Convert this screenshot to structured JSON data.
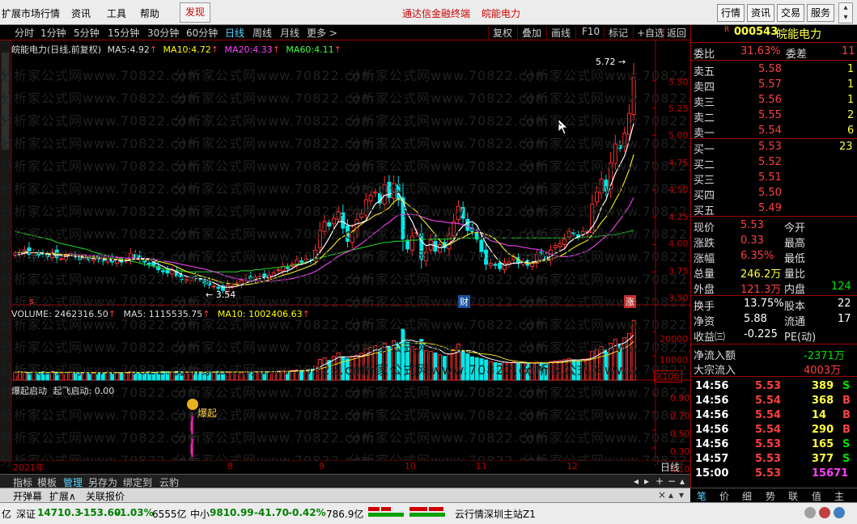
{
  "menubar": {
    "items": [
      "扩展市场行情",
      "资讯",
      "工具",
      "帮助"
    ],
    "discover": "发现",
    "title_app": "通达信金融终端",
    "title_stock": "皖能电力",
    "right_buttons": [
      "行情",
      "资讯",
      "交易",
      "服务"
    ]
  },
  "period_toolbar": {
    "periods": [
      "分时",
      "1分钟",
      "5分钟",
      "15分钟",
      "30分钟",
      "60分钟",
      "日线",
      "周线",
      "月线",
      "更多 >"
    ],
    "active": "日线",
    "tools": [
      "复权",
      "叠加",
      "画线",
      "F10",
      "标记",
      "+自选",
      "返回"
    ]
  },
  "price_header": {
    "name": "皖能电力(日线,前复权)",
    "ma5_label": "MA5:",
    "ma5": "4.92",
    "ma10_label": "MA10:",
    "ma10": "4.72",
    "ma20_label": "MA20:",
    "ma20": "4.33",
    "ma60_label": "MA60:",
    "ma60": "4.11"
  },
  "volume_header": {
    "label": "VOLUME:",
    "value": "2462316.50",
    "ma5_label": "MA5:",
    "ma5": "1115535.75",
    "ma10_label": "MA10:",
    "ma10": "1002406.63"
  },
  "indicator_header": {
    "text1": "爆起启动",
    "text2": "起飞启动: 0.00"
  },
  "indicator_marker": "爆起",
  "price_axis": [
    "5.50",
    "5.25",
    "5.00",
    "4.75",
    "4.50",
    "4.25",
    "4.00",
    "3.75",
    "3.50"
  ],
  "volume_axis": [
    "20000",
    "10000"
  ],
  "volume_unit": "X100",
  "indicator_axis": [
    "0.90",
    "0.70",
    "0.50",
    "0.30",
    "0.10"
  ],
  "annotations": {
    "high": "5.72",
    "low": "3.54"
  },
  "event_markers": {
    "s": "s",
    "cai": "财",
    "zhang": "涨"
  },
  "date_axis": {
    "year": "2021年",
    "months": [
      "8",
      "9",
      "10",
      "11",
      "12"
    ]
  },
  "period_label": "日线",
  "watermark": "分析家公式网www.70822.com",
  "chart_data": {
    "type": "candlestick",
    "title": "皖能电力(日线,前复权)",
    "ylim": [
      3.5,
      5.72
    ],
    "close": [
      3.92,
      3.93,
      3.95,
      3.91,
      3.93,
      3.9,
      3.91,
      3.89,
      3.93,
      3.88,
      3.87,
      3.9,
      3.92,
      3.89,
      3.86,
      3.88,
      3.86,
      3.87,
      3.87,
      3.85,
      3.86,
      3.84,
      3.86,
      3.84,
      3.86,
      3.92,
      3.88,
      3.87,
      3.84,
      3.82,
      3.81,
      3.77,
      3.75,
      3.74,
      3.76,
      3.71,
      3.68,
      3.68,
      3.69,
      3.7,
      3.68,
      3.64,
      3.63,
      3.62,
      3.6,
      3.58,
      3.63,
      3.62,
      3.65,
      3.67,
      3.69,
      3.69,
      3.7,
      3.71,
      3.7,
      3.72,
      3.74,
      3.77,
      3.8,
      3.78,
      3.82,
      3.86,
      3.84,
      3.87,
      3.86,
      3.95,
      4.13,
      4.21,
      4.17,
      4.24,
      4.3,
      4.15,
      4.03,
      4.13,
      4.23,
      4.28,
      4.41,
      4.45,
      4.48,
      4.38,
      4.55,
      4.43,
      4.56,
      4.41,
      4.05,
      3.96,
      4.08,
      4.11,
      3.86,
      3.93,
      4.04,
      3.94,
      4,
      3.97,
      4.09,
      4.21,
      4.35,
      4.24,
      4.13,
      4.12,
      4.05,
      3.93,
      3.82,
      3.83,
      3.81,
      3.78,
      3.83,
      3.84,
      3.89,
      3.83,
      3.84,
      3.81,
      3.84,
      3.91,
      3.9,
      3.86,
      3.95,
      3.99,
      4.01,
      4.05,
      4.12,
      4.1,
      4.07,
      4.12,
      4.12,
      4.37,
      4.48,
      4.6,
      4.49,
      4.75,
      4.92,
      4.88,
      5.02,
      5.2,
      5.53
    ],
    "ma5": [
      3.9,
      3.91,
      3.92,
      3.93,
      3.93,
      3.93,
      3.92,
      3.91,
      3.91,
      3.9,
      3.9,
      3.89,
      3.9,
      3.89,
      3.89,
      3.88,
      3.88,
      3.87,
      3.87,
      3.87,
      3.86,
      3.86,
      3.86,
      3.85,
      3.85,
      3.86,
      3.87,
      3.87,
      3.87,
      3.87,
      3.84,
      3.82,
      3.8,
      3.78,
      3.77,
      3.75,
      3.73,
      3.71,
      3.7,
      3.69,
      3.69,
      3.68,
      3.67,
      3.65,
      3.63,
      3.61,
      3.61,
      3.61,
      3.62,
      3.63,
      3.65,
      3.66,
      3.68,
      3.69,
      3.7,
      3.7,
      3.71,
      3.73,
      3.75,
      3.76,
      3.78,
      3.81,
      3.82,
      3.83,
      3.85,
      3.88,
      3.93,
      3.99,
      4.06,
      4.14,
      4.21,
      4.21,
      4.18,
      4.17,
      4.19,
      4.2,
      4.22,
      4.3,
      4.37,
      4.4,
      4.45,
      4.46,
      4.48,
      4.47,
      4.4,
      4.28,
      4.21,
      4.11,
      4.03,
      3.99,
      4,
      3.99,
      3.97,
      3.98,
      4.01,
      4.04,
      4.12,
      4.17,
      4.2,
      4.21,
      4.18,
      4.09,
      4.01,
      3.95,
      3.89,
      3.84,
      3.81,
      3.82,
      3.83,
      3.83,
      3.84,
      3.84,
      3.84,
      3.85,
      3.86,
      3.87,
      3.89,
      3.92,
      3.94,
      3.96,
      4.02,
      4.05,
      4.07,
      4.09,
      4.11,
      4.16,
      4.23,
      4.34,
      4.41,
      4.54,
      4.65,
      4.73,
      4.81,
      4.95,
      5.11
    ],
    "ma60": [
      4.12,
      4.11,
      4.1,
      4.09,
      4.08,
      4.07,
      4.06,
      4.05,
      4.04,
      4.02,
      4.01,
      4,
      3.99,
      3.98,
      3.97,
      3.96,
      3.95,
      3.93,
      3.92,
      3.91,
      3.9,
      3.89,
      3.88,
      3.87,
      3.86,
      3.85,
      3.84,
      3.83,
      3.82,
      3.81,
      3.8,
      3.79,
      3.78,
      3.77,
      3.77,
      3.76,
      3.76,
      3.75,
      3.75,
      3.75,
      3.75,
      3.75,
      3.75,
      3.75,
      3.75,
      3.75,
      3.75,
      3.75,
      3.75,
      3.76,
      3.76,
      3.76,
      3.77,
      3.77,
      3.78,
      3.78,
      3.79,
      3.79,
      3.8,
      3.8,
      3.81,
      3.82,
      3.83,
      3.84,
      3.85,
      3.87,
      3.88,
      3.89,
      3.9,
      3.91,
      3.92,
      3.93,
      3.94,
      3.95,
      3.96,
      3.97,
      3.98,
      3.99,
      4.0,
      4.01,
      4.02,
      4.02,
      4.03,
      4.03,
      4.03,
      4.04,
      4.04,
      4.04,
      4.05,
      4.05,
      4.05,
      4.05,
      4.05,
      4.05,
      4.05,
      4.06,
      4.06,
      4.06,
      4.06,
      4.06,
      4.06,
      4.06,
      4.06,
      4.06,
      4.06,
      4.06,
      4.06,
      4.06,
      4.06,
      4.06,
      4.06,
      4.06,
      4.06,
      4.06,
      4.06,
      4.06,
      4.06,
      4.06,
      4.06,
      4.06,
      4.06,
      4.06,
      4.06,
      4.07,
      4.07,
      4.07,
      4.07,
      4.08,
      4.08,
      4.09,
      4.09,
      4.1,
      4.11,
      4.12,
      4.13
    ],
    "volume": [
      3200,
      3500,
      3100,
      2900,
      3300,
      3000,
      3400,
      2800,
      3600,
      3200,
      3000,
      3100,
      3300,
      2900,
      3100,
      3000,
      2800,
      3200,
      3100,
      2900,
      3300,
      3000,
      3100,
      2800,
      3200,
      3500,
      3300,
      3100,
      3200,
      3400,
      3000,
      3300,
      3500,
      3400,
      3200,
      3600,
      3300,
      3100,
      3200,
      3400,
      3300,
      3100,
      3500,
      3200,
      3600,
      3400,
      3200,
      3300,
      3400,
      3200,
      3500,
      3300,
      3400,
      3600,
      3500,
      3300,
      3500,
      3700,
      3800,
      3600,
      4000,
      4200,
      3900,
      4100,
      4500,
      5800,
      8500,
      9200,
      8100,
      9800,
      11200,
      9600,
      8800,
      9400,
      10300,
      11100,
      12800,
      13500,
      14200,
      12400,
      15100,
      13900,
      16200,
      15400,
      21000,
      15600,
      13800,
      12900,
      16800,
      12100,
      11800,
      11200,
      10400,
      9800,
      10600,
      12600,
      14900,
      12100,
      10800,
      9600,
      9200,
      8800,
      8300,
      7600,
      7200,
      6900,
      7300,
      7100,
      7500,
      6800,
      7000,
      6600,
      7100,
      7400,
      7200,
      6900,
      7600,
      7900,
      8100,
      8400,
      8900,
      8300,
      7800,
      8600,
      8800,
      11800,
      12600,
      13800,
      12400,
      15200,
      16800,
      14900,
      17400,
      19200,
      24600
    ],
    "indicator": {
      "爆起启动_index": 84,
      "起飞启动": 0.0
    }
  },
  "right_panel": {
    "code": "000543",
    "name": "皖能电力",
    "r": "R",
    "weibi_label": "委比",
    "weibi": "31.63%",
    "weicha_label": "委差",
    "weicha": "11",
    "asks": [
      [
        "卖五",
        "5.58",
        "1"
      ],
      [
        "卖四",
        "5.57",
        "1"
      ],
      [
        "卖三",
        "5.56",
        "1"
      ],
      [
        "卖二",
        "5.55",
        "2"
      ],
      [
        "卖一",
        "5.54",
        "6"
      ]
    ],
    "bids": [
      [
        "买一",
        "5.53",
        "23"
      ],
      [
        "买二",
        "5.52",
        ""
      ],
      [
        "买三",
        "5.51",
        ""
      ],
      [
        "买四",
        "5.50",
        ""
      ],
      [
        "买五",
        "5.49",
        ""
      ]
    ],
    "quote": [
      [
        "现价",
        "5.53",
        "今开",
        ""
      ],
      [
        "涨跌",
        "0.33",
        "最高",
        ""
      ],
      [
        "涨幅",
        "6.35%",
        "最低",
        ""
      ],
      [
        "总量",
        "246.2万",
        "量比",
        ""
      ],
      [
        "外盘",
        "121.3万",
        "内盘",
        "124"
      ]
    ],
    "fund": [
      [
        "换手",
        "13.75%",
        "股本",
        "22"
      ],
      [
        "净资",
        "5.88",
        "流通",
        "17"
      ],
      [
        "收益㈢",
        "-0.225",
        "PE(动)",
        ""
      ]
    ],
    "flow": [
      [
        "净流入额",
        "-2371万"
      ],
      [
        "大宗流入",
        "4003万"
      ]
    ],
    "trades": [
      [
        "14:56",
        "5.53",
        "389",
        "S"
      ],
      [
        "14:56",
        "5.54",
        "368",
        "B"
      ],
      [
        "14:56",
        "5.54",
        "14",
        "B"
      ],
      [
        "14:56",
        "5.54",
        "290",
        "B"
      ],
      [
        "14:56",
        "5.53",
        "165",
        "S"
      ],
      [
        "14:57",
        "5.53",
        "377",
        "S"
      ],
      [
        "15:00",
        "5.53",
        "15671",
        ""
      ]
    ]
  },
  "bottom_toolbar": [
    "指标",
    "模板",
    "管理",
    "另存为",
    "绑定到",
    "云豹"
  ],
  "bottom2": [
    "开弹幕",
    "扩展∧",
    "关联报价"
  ],
  "right_tabs": [
    "笔",
    "价",
    "细",
    "势",
    "联",
    "值",
    "主"
  ],
  "status": {
    "s1": "亿",
    "sz_label": "深证",
    "sz_val": "14710.3",
    "sz_chg": "-153.60",
    "sz_pct": "-1.03%",
    "sz_amt": "6555亿",
    "zx_label": "中小",
    "zx_val": "9810.99",
    "zx_chg": "-41.70",
    "zx_pct": "-0.42%",
    "zx_amt": "786.9亿",
    "server": "云行情深圳主站Z1"
  }
}
